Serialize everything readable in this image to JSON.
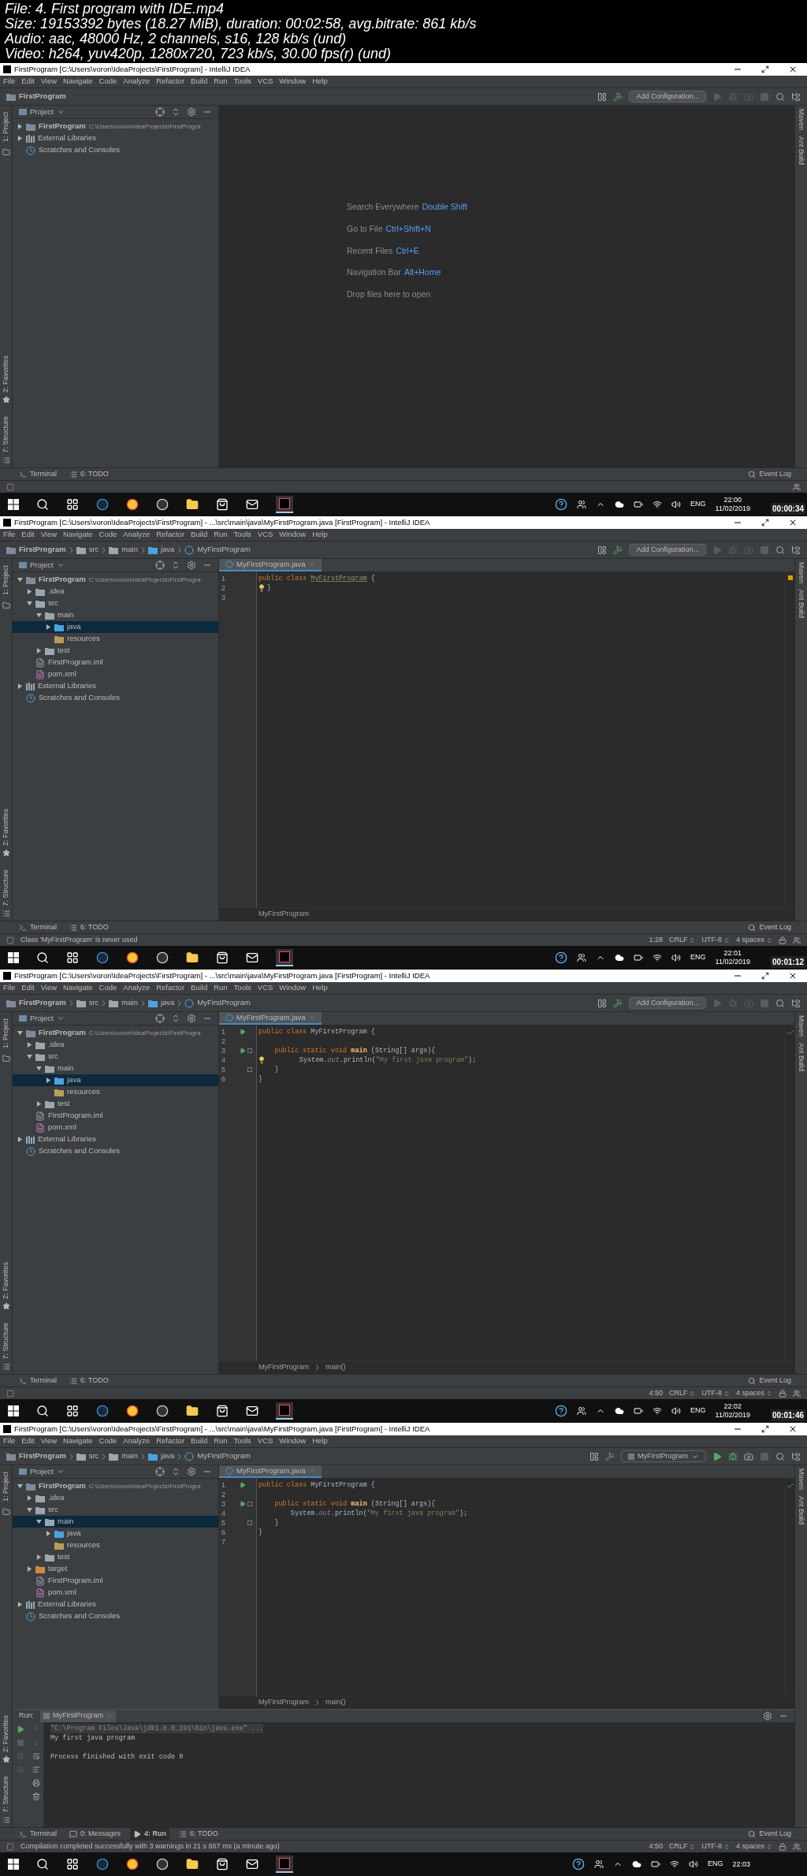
{
  "sheet_info": [
    "File: 4. First program with IDE.mp4",
    "Size: 19153392 bytes (18.27 MiB), duration: 00:02:58, avg.bitrate: 861 kb/s",
    "Audio: aac, 48000 Hz, 2 channels, s16, 128 kb/s (und)",
    "Video: h264, yuv420p, 1280x720, 723 kb/s, 30.00 fps(r) (und)"
  ],
  "frames": [
    {
      "title": "FirstProgram [C:\\Users\\voron\\IdeaProjects\\FirstProgram] - IntelliJ IDEA",
      "menu": [
        "File",
        "Edit",
        "View",
        "Navigate",
        "Code",
        "Analyze",
        "Refactor",
        "Build",
        "Run",
        "Tools",
        "VCS",
        "Window",
        "Help"
      ],
      "breadcrumb": [
        {
          "kind": "project",
          "label": "FirstProgram"
        }
      ],
      "toolbar": {
        "config": {
          "kind": "button",
          "label": "Add Configuration..."
        },
        "run_enabled": false
      },
      "left_tabs": [
        "1: Project",
        "2: Favorites",
        "7: Structure"
      ],
      "right_tabs": [
        "Maven",
        "Ant Build"
      ],
      "project_panel": {
        "title": "Project",
        "tree": [
          {
            "kind": "project",
            "label": "FirstProgram",
            "detail": "C:\\Users\\voron\\IdeaProjects\\FirstProgra",
            "expanded": false,
            "selected": false
          },
          {
            "kind": "library",
            "label": "External Libraries",
            "expanded": false,
            "selected": false
          },
          {
            "kind": "scratches",
            "label": "Scratches and Consoles",
            "selected": false
          }
        ]
      },
      "welcome": [
        {
          "action": "Search Everywhere",
          "shortcut": "Double Shift"
        },
        {
          "action": "Go to File",
          "shortcut": "Ctrl+Shift+N"
        },
        {
          "action": "Recent Files",
          "shortcut": "Ctrl+E"
        },
        {
          "action": "Navigation Bar",
          "shortcut": "Alt+Home"
        },
        {
          "action": "Drop files here to open"
        }
      ],
      "tool_tabs": [
        {
          "label": "Terminal",
          "kind": "terminal",
          "selected": false
        },
        {
          "label": "6: TODO",
          "kind": "todo",
          "selected": false
        }
      ],
      "event_log": "Event Log",
      "taskbar": {
        "lang": "ENG",
        "time": "22:00",
        "date": "11/02/2019"
      },
      "timestamp": "00:00:34"
    },
    {
      "title": "FirstProgram [C:\\Users\\voron\\IdeaProjects\\FirstProgram] - ...\\src\\main\\java\\MyFirstProgram.java [FirstProgram] - IntelliJ IDEA",
      "menu": [
        "File",
        "Edit",
        "View",
        "Navigate",
        "Code",
        "Analyze",
        "Refactor",
        "Build",
        "Run",
        "Tools",
        "VCS",
        "Window",
        "Help"
      ],
      "breadcrumb": [
        {
          "kind": "project",
          "label": "FirstProgram"
        },
        {
          "kind": "folder",
          "label": "src"
        },
        {
          "kind": "folder",
          "label": "main"
        },
        {
          "kind": "source-folder",
          "label": "java"
        },
        {
          "kind": "class",
          "label": "MyFirstProgram"
        }
      ],
      "toolbar": {
        "config": {
          "kind": "button",
          "label": "Add Configuration..."
        },
        "run_enabled": false
      },
      "left_tabs": [
        "1: Project",
        "2: Favorites",
        "7: Structure"
      ],
      "right_tabs": [
        "Maven",
        "Ant Build"
      ],
      "project_panel": {
        "title": "Project",
        "tree": [
          {
            "kind": "project",
            "label": "FirstProgram",
            "detail": "C:\\Users\\voron\\IdeaProjects\\FirstProgra",
            "expanded": true,
            "selected": false,
            "children": [
              {
                "kind": "folder",
                "label": ".idea",
                "expanded": false,
                "selected": false
              },
              {
                "kind": "folder",
                "label": "src",
                "expanded": true,
                "selected": false,
                "children": [
                  {
                    "kind": "folder",
                    "label": "main",
                    "expanded": true,
                    "selected": false,
                    "children": [
                      {
                        "kind": "source-folder",
                        "label": "java",
                        "expanded": false,
                        "selected": true
                      },
                      {
                        "kind": "resources-folder",
                        "label": "resources",
                        "selected": false
                      }
                    ]
                  },
                  {
                    "kind": "folder",
                    "label": "test",
                    "expanded": false,
                    "selected": false
                  }
                ]
              },
              {
                "kind": "module-file",
                "label": "FirstProgram.iml",
                "selected": false
              },
              {
                "kind": "maven-file",
                "label": "pom.xml",
                "selected": false
              }
            ]
          },
          {
            "kind": "library",
            "label": "External Libraries",
            "expanded": false,
            "selected": false
          },
          {
            "kind": "scratches",
            "label": "Scratches and Consoles",
            "selected": false
          }
        ]
      },
      "editor": {
        "tab": "MyFirstProgram.java",
        "inspection_marker": {
          "kind": "warning"
        },
        "lines": [
          {
            "number": "1",
            "tokens": [
              {
                "kind": "keyword",
                "text": "public class "
              },
              {
                "kind": "unused",
                "text": "MyFirstProgram"
              },
              {
                "kind": "plain",
                "text": " {"
              }
            ]
          },
          {
            "number": "2",
            "bulb": true,
            "tokens": [
              {
                "kind": "plain",
                "text": "}"
              }
            ]
          },
          {
            "number": "3"
          }
        ],
        "breadcrumb": [
          "MyFirstProgram"
        ]
      },
      "tool_tabs": [
        {
          "label": "Terminal",
          "kind": "terminal",
          "selected": false
        },
        {
          "label": "6: TODO",
          "kind": "todo",
          "selected": false
        }
      ],
      "event_log": "Event Log",
      "status": {
        "message": "Class 'MyFirstProgram' is never used",
        "indicators": [
          {
            "text": "1:28",
            "dropdown": false
          },
          {
            "text": "CRLF",
            "dropdown": true
          },
          {
            "text": "UTF-8",
            "dropdown": true
          },
          {
            "text": "4 spaces",
            "dropdown": true
          }
        ]
      },
      "taskbar": {
        "lang": "ENG",
        "time": "22:01",
        "date": "11/02/2019"
      },
      "timestamp": "00:01:12"
    },
    {
      "title": "FirstProgram [C:\\Users\\voron\\IdeaProjects\\FirstProgram] - ...\\src\\main\\java\\MyFirstProgram.java [FirstProgram] - IntelliJ IDEA",
      "menu": [
        "File",
        "Edit",
        "View",
        "Navigate",
        "Code",
        "Analyze",
        "Refactor",
        "Build",
        "Run",
        "Tools",
        "VCS",
        "Window",
        "Help"
      ],
      "breadcrumb": [
        {
          "kind": "project",
          "label": "FirstProgram"
        },
        {
          "kind": "folder",
          "label": "src"
        },
        {
          "kind": "folder",
          "label": "main"
        },
        {
          "kind": "source-folder",
          "label": "java"
        },
        {
          "kind": "class",
          "label": "MyFirstProgram"
        }
      ],
      "toolbar": {
        "config": {
          "kind": "button",
          "label": "Add Configuration..."
        },
        "run_enabled": false
      },
      "left_tabs": [
        "1: Project",
        "2: Favorites",
        "7: Structure"
      ],
      "right_tabs": [
        "Maven",
        "Ant Build"
      ],
      "project_panel": {
        "title": "Project",
        "tree": [
          {
            "kind": "project",
            "label": "FirstProgram",
            "detail": "C:\\Users\\voron\\IdeaProjects\\FirstProgra",
            "expanded": true,
            "selected": false,
            "children": [
              {
                "kind": "folder",
                "label": ".idea",
                "expanded": false,
                "selected": false
              },
              {
                "kind": "folder",
                "label": "src",
                "expanded": true,
                "selected": false,
                "children": [
                  {
                    "kind": "folder",
                    "label": "main",
                    "expanded": true,
                    "selected": false,
                    "children": [
                      {
                        "kind": "source-folder",
                        "label": "java",
                        "expanded": false,
                        "selected": true
                      },
                      {
                        "kind": "resources-folder",
                        "label": "resources",
                        "selected": false
                      }
                    ]
                  },
                  {
                    "kind": "folder",
                    "label": "test",
                    "expanded": false,
                    "selected": false
                  }
                ]
              },
              {
                "kind": "module-file",
                "label": "FirstProgram.iml",
                "selected": false
              },
              {
                "kind": "maven-file",
                "label": "pom.xml",
                "selected": false
              }
            ]
          },
          {
            "kind": "library",
            "label": "External Libraries",
            "expanded": false,
            "selected": false
          },
          {
            "kind": "scratches",
            "label": "Scratches and Consoles",
            "selected": false
          }
        ]
      },
      "editor": {
        "tab": "MyFirstProgram.java",
        "inspection_marker": {
          "kind": "ok"
        },
        "lines": [
          {
            "number": "1",
            "run": true,
            "tokens": [
              {
                "kind": "keyword",
                "text": "public class "
              },
              {
                "kind": "plain",
                "text": "MyFirstProgram {"
              }
            ]
          },
          {
            "number": "2"
          },
          {
            "number": "3",
            "run": true,
            "fold": true,
            "tokens": [
              {
                "kind": "keyword",
                "text": "    public static void "
              },
              {
                "kind": "method",
                "text": "main"
              },
              {
                "kind": "plain",
                "text": " (String[] args){"
              }
            ]
          },
          {
            "number": "4",
            "bulb": true,
            "tokens": [
              {
                "kind": "plain",
                "text": "        System."
              },
              {
                "kind": "field",
                "text": "out"
              },
              {
                "kind": "plain",
                "text": ".println("
              },
              {
                "kind": "string",
                "text": "\"My first java program\""
              },
              {
                "kind": "plain",
                "text": ");"
              }
            ]
          },
          {
            "number": "5",
            "fold": true,
            "tokens": [
              {
                "kind": "plain",
                "text": "    }"
              }
            ]
          },
          {
            "number": "6",
            "tokens": [
              {
                "kind": "plain",
                "text": "}"
              }
            ]
          }
        ],
        "breadcrumb": [
          "MyFirstProgram",
          "main()"
        ]
      },
      "tool_tabs": [
        {
          "label": "Terminal",
          "kind": "terminal",
          "selected": false
        },
        {
          "label": "6: TODO",
          "kind": "todo",
          "selected": false
        }
      ],
      "event_log": "Event Log",
      "status": {
        "indicators": [
          {
            "text": "4:50",
            "dropdown": false
          },
          {
            "text": "CRLF",
            "dropdown": true
          },
          {
            "text": "UTF-8",
            "dropdown": true
          },
          {
            "text": "4 spaces",
            "dropdown": true
          }
        ]
      },
      "taskbar": {
        "lang": "ENG",
        "time": "22:02",
        "date": "11/02/2019"
      },
      "timestamp": "00:01:46"
    },
    {
      "title": "FirstProgram [C:\\Users\\voron\\IdeaProjects\\FirstProgram] - ...\\src\\main\\java\\MyFirstProgram.java [FirstProgram] - IntelliJ IDEA",
      "menu": [
        "File",
        "Edit",
        "View",
        "Navigate",
        "Code",
        "Analyze",
        "Refactor",
        "Build",
        "Run",
        "Tools",
        "VCS",
        "Window",
        "Help"
      ],
      "breadcrumb": [
        {
          "kind": "project",
          "label": "FirstProgram"
        },
        {
          "kind": "folder",
          "label": "src"
        },
        {
          "kind": "folder",
          "label": "main"
        },
        {
          "kind": "source-folder",
          "label": "java"
        },
        {
          "kind": "class",
          "label": "MyFirstProgram"
        }
      ],
      "toolbar": {
        "config": {
          "kind": "dropdown",
          "label": "MyFirstProgram"
        },
        "run_enabled": true
      },
      "left_tabs": [
        "1: Project",
        "2: Favorites",
        "7: Structure"
      ],
      "right_tabs": [
        "Maven",
        "Ant Build"
      ],
      "project_panel": {
        "title": "Project",
        "tree": [
          {
            "kind": "project",
            "label": "FirstProgram",
            "detail": "C:\\Users\\voron\\IdeaProjects\\FirstProgra",
            "expanded": true,
            "selected": false,
            "children": [
              {
                "kind": "folder",
                "label": ".idea",
                "expanded": false,
                "selected": false
              },
              {
                "kind": "folder",
                "label": "src",
                "expanded": true,
                "selected": false,
                "children": [
                  {
                    "kind": "folder",
                    "label": "main",
                    "expanded": true,
                    "selected": true,
                    "children": [
                      {
                        "kind": "source-folder",
                        "label": "java",
                        "expanded": false,
                        "selected": false
                      },
                      {
                        "kind": "resources-folder",
                        "label": "resources",
                        "selected": false
                      }
                    ]
                  },
                  {
                    "kind": "folder",
                    "label": "test",
                    "expanded": false,
                    "selected": false
                  }
                ]
              },
              {
                "kind": "excluded-folder",
                "label": "target",
                "expanded": false,
                "selected": false
              },
              {
                "kind": "module-file",
                "label": "FirstProgram.iml",
                "selected": false
              },
              {
                "kind": "maven-file",
                "label": "pom.xml",
                "selected": false
              }
            ]
          },
          {
            "kind": "library",
            "label": "External Libraries",
            "expanded": false,
            "selected": false
          },
          {
            "kind": "scratches",
            "label": "Scratches and Consoles",
            "selected": false
          }
        ]
      },
      "editor": {
        "tab": "MyFirstProgram.java",
        "inspection_marker": {
          "kind": "ok"
        },
        "lines": [
          {
            "number": "1",
            "run": true,
            "tokens": [
              {
                "kind": "keyword",
                "text": "public class "
              },
              {
                "kind": "plain",
                "text": "MyFirstProgram {"
              }
            ]
          },
          {
            "number": "2"
          },
          {
            "number": "3",
            "run": true,
            "fold": true,
            "tokens": [
              {
                "kind": "keyword",
                "text": "    public static void "
              },
              {
                "kind": "method",
                "text": "main"
              },
              {
                "kind": "plain",
                "text": " (String[] args){"
              }
            ]
          },
          {
            "number": "4",
            "tokens": [
              {
                "kind": "plain",
                "text": "        System."
              },
              {
                "kind": "field",
                "text": "out"
              },
              {
                "kind": "plain",
                "text": ".println("
              },
              {
                "kind": "string",
                "text": "\"My first java program\""
              },
              {
                "kind": "plain",
                "text": ");"
              }
            ]
          },
          {
            "number": "5",
            "fold": true,
            "tokens": [
              {
                "kind": "plain",
                "text": "    }"
              }
            ]
          },
          {
            "number": "6",
            "tokens": [
              {
                "kind": "plain",
                "text": "}"
              }
            ]
          },
          {
            "number": "7"
          }
        ],
        "breadcrumb": [
          "MyFirstProgram",
          "main()"
        ]
      },
      "run_panel": {
        "label": "Run:",
        "tab": "MyFirstProgram",
        "output": [
          {
            "kind": "command",
            "text": "\"C:\\Program Files\\Java\\jdk1.8.0_191\\bin\\java.exe\" ..."
          },
          {
            "kind": "stdout",
            "text": "My first java program"
          },
          {
            "kind": "blank"
          },
          {
            "kind": "stdout",
            "text": "Process finished with exit code 0"
          }
        ]
      },
      "tool_tabs": [
        {
          "label": "Terminal",
          "kind": "terminal",
          "selected": false
        },
        {
          "label": "0: Messages",
          "kind": "messages",
          "selected": false
        },
        {
          "label": "4: Run",
          "kind": "run",
          "selected": true
        },
        {
          "label": "6: TODO",
          "kind": "todo",
          "selected": false
        }
      ],
      "event_log": "Event Log",
      "status": {
        "message": "Compilation completed successfully with 3 warnings in 21 s 667 ms (a minute ago)",
        "indicators": [
          {
            "text": "4:50",
            "dropdown": false
          },
          {
            "text": "CRLF",
            "dropdown": true
          },
          {
            "text": "UTF-8",
            "dropdown": true
          },
          {
            "text": "4 spaces",
            "dropdown": true
          }
        ]
      },
      "taskbar": {
        "lang": "ENG",
        "time": "22:03"
      }
    }
  ]
}
